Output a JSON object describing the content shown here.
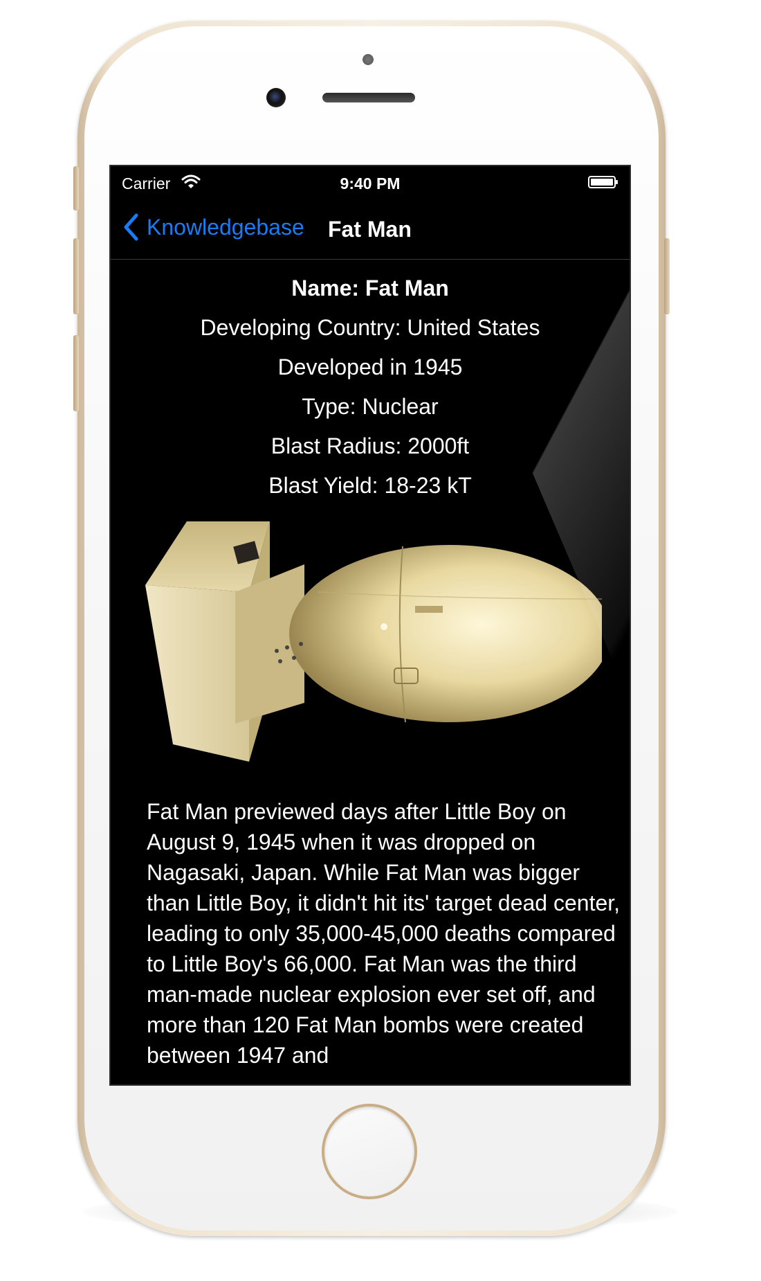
{
  "status_bar": {
    "carrier": "Carrier",
    "time": "9:40 PM"
  },
  "nav": {
    "back_label": "Knowledgebase",
    "title": "Fat Man",
    "accent_color": "#1a7cf5"
  },
  "details": {
    "name": "Name: Fat Man",
    "country": "Developing Country: United States",
    "developed": "Developed in 1945",
    "type": "Type: Nuclear",
    "blast_radius": "Blast Radius: 2000ft",
    "blast_yield": "Blast Yield: 18-23 kT"
  },
  "description": "Fat Man previewed days after Little Boy on August 9, 1945 when it was dropped on Nagasaki, Japan. While Fat Man was bigger than Little Boy, it didn't hit its' target dead center, leading to only 35,000-45,000 deaths compared to Little Boy's 66,000. Fat Man was the third man-made nuclear explosion ever set off, and more than 120 Fat Man bombs were created between 1947 and",
  "icons": [
    "wifi-icon",
    "battery-icon",
    "chevron-left-icon"
  ]
}
